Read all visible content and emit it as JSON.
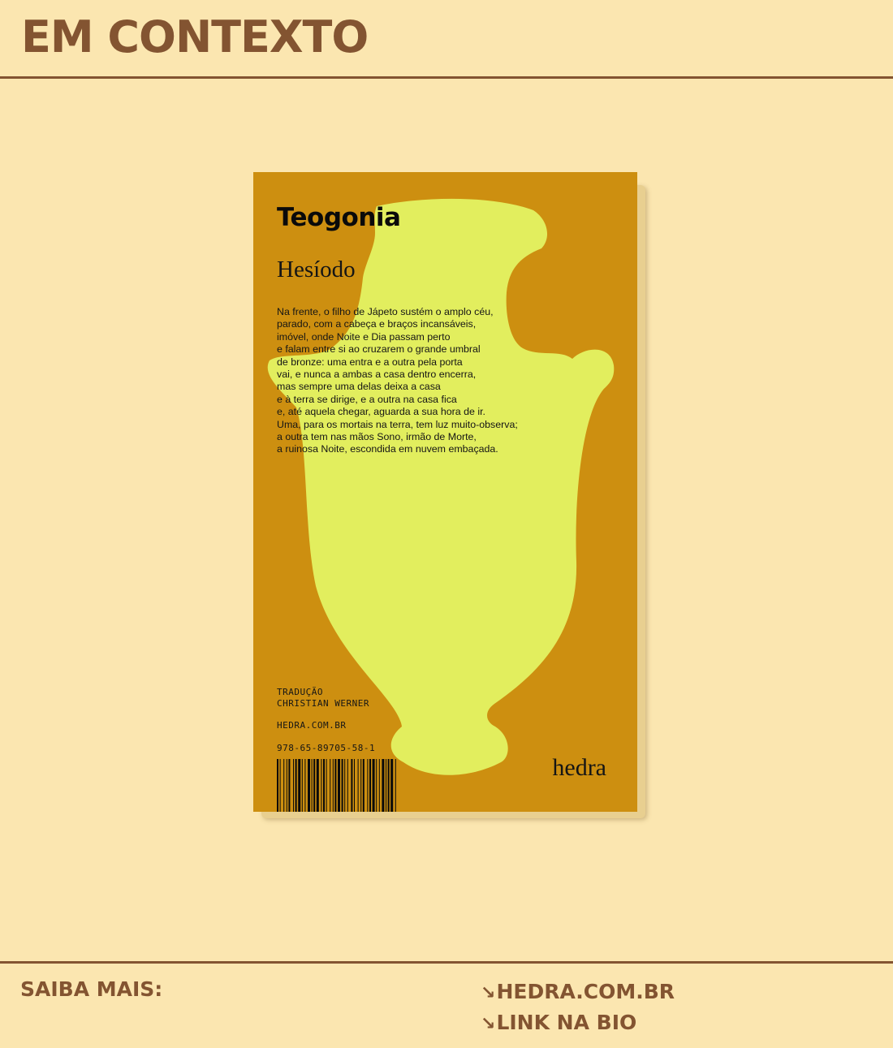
{
  "header": {
    "title": "EM CONTEXTO"
  },
  "book": {
    "title": "Teogonia",
    "author": "Hesíodo",
    "excerpt": "Na frente, o filho de Jápeto sustém o amplo céu,\nparado, com a cabeça e braços incansáveis,\nimóvel, onde Noite e Dia passam perto\ne falam entre si ao cruzarem o grande umbral\nde bronze: uma entra e a outra pela porta\nvai, e nunca a ambas a casa dentro encerra,\nmas sempre uma delas deixa a casa\ne à terra se dirige, e a outra na casa fica\ne, até aquela chegar, aguarda a sua hora de ir.\nUma, para os mortais na terra, tem luz muito-observa;\na outra tem nas mãos Sono, irmão de Morte,\na ruinosa Noite, escondida em nuvem embaçada.",
    "translator": "TRADUÇÃO\nCHRISTIAN WERNER",
    "site": "HEDRA.COM.BR",
    "isbn": "978-65-89705-58-1",
    "publisher": "hedra",
    "icon": "vase-illustration",
    "colors": {
      "cover": "#cd8f10",
      "vase": "#e2ee5e"
    }
  },
  "footer": {
    "label": "SAIBA MAIS:",
    "arrow": "↘",
    "links": [
      {
        "label": "HEDRA.COM.BR"
      },
      {
        "label": "LINK NA BIO"
      }
    ]
  },
  "colors": {
    "background": "#fbe6b0",
    "accent": "#835431"
  }
}
